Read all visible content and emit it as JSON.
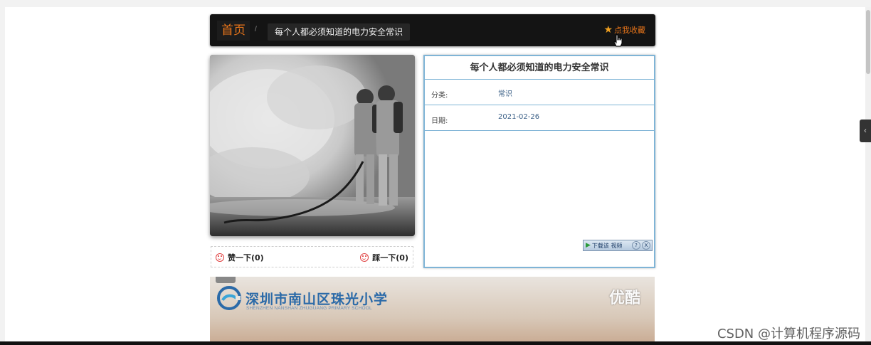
{
  "breadcrumb": {
    "home": "首页",
    "separator": "/",
    "current": "每个人都必须知道的电力安全常识"
  },
  "favorite": {
    "icon": "star-icon",
    "label": "点我收藏"
  },
  "article": {
    "title": "每个人都必须知道的电力安全常识",
    "category_label": "分类:",
    "category_value": "常识",
    "date_label": "日期:",
    "date_value": "2021-02-26"
  },
  "votes": {
    "up_label": "赞一下(0)",
    "down_label": "踩一下(0)"
  },
  "download_plugin": {
    "label": "下载该 视频",
    "help": "?",
    "close": "X"
  },
  "video": {
    "school_name": "深圳市南山区珠光小学",
    "school_name_en": "SHENZHEN NANSHAN ZHUGUANG PRIMARY SCHOOL",
    "brand": "优酷"
  },
  "watermark": "CSDN @计算机程序源码",
  "colors": {
    "accent": "#e8751a",
    "panel_border": "#7fb4d6",
    "link": "#3a5f86"
  }
}
